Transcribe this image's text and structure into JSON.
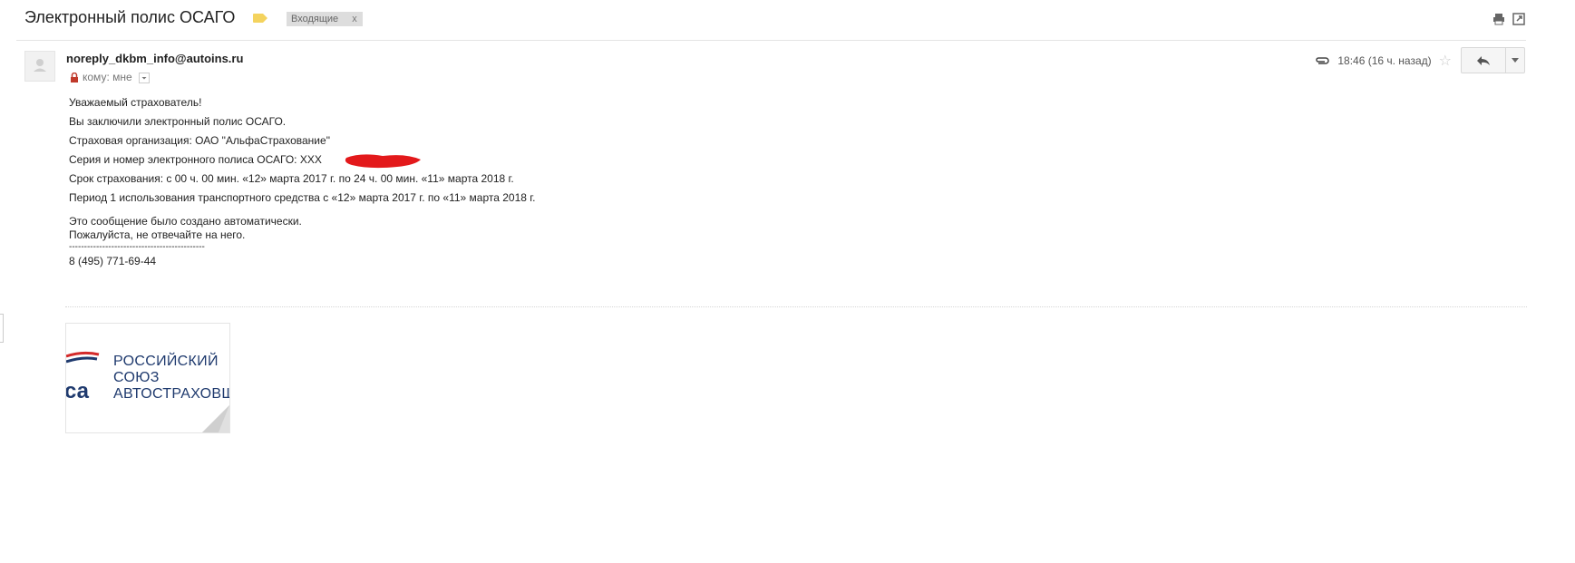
{
  "email": {
    "subject": "Электронный полис ОСАГО",
    "label_chip": "Входящие",
    "label_remove": "x",
    "sender": "noreply_dkbm_info@autoins.ru",
    "to_label": "кому: мне",
    "time": "18:46 (16 ч. назад)"
  },
  "body": {
    "lines": [
      "Уважаемый страхователь!",
      "Вы заключили электронный полис ОСАГО.",
      "Страховая организация: ОАО \"АльфаСтрахование\"",
      "Серия и номер электронного полиса ОСАГО: ХХХ",
      "Срок страхования: с 00 ч. 00 мин. «12» марта 2017 г. по 24 ч. 00 мин. «11» марта 2018 г.",
      "Период 1 использования транспортного средства с «12» марта 2017 г. по «11» марта 2018 г."
    ],
    "auto_note": "Это сообщение было создано автоматически.",
    "no_reply": "Пожалуйста, не отвечайте на него.",
    "separator": "---------------------------------------------",
    "phone": "8 (495) 771-69-44"
  },
  "attachment": {
    "logo_text": "РОССИЙСКИЙ\nСОЮЗ\nАВТОСТРАХОВЩИКОВ"
  },
  "icons": {
    "label": "label-tag-icon",
    "print": "print-icon",
    "popout": "open-in-new-window-icon",
    "lock": "lock-icon",
    "caret": "chevron-down-icon",
    "attachment": "paperclip-icon",
    "star": "star-icon",
    "reply": "reply-icon",
    "more": "more-dropdown-icon"
  },
  "colors": {
    "label_tag": "#f4d35e",
    "chip_bg": "#dddddd",
    "logo_blue": "#1f3a6e",
    "logo_red": "#d42a2a",
    "redaction": "#e3191b"
  }
}
